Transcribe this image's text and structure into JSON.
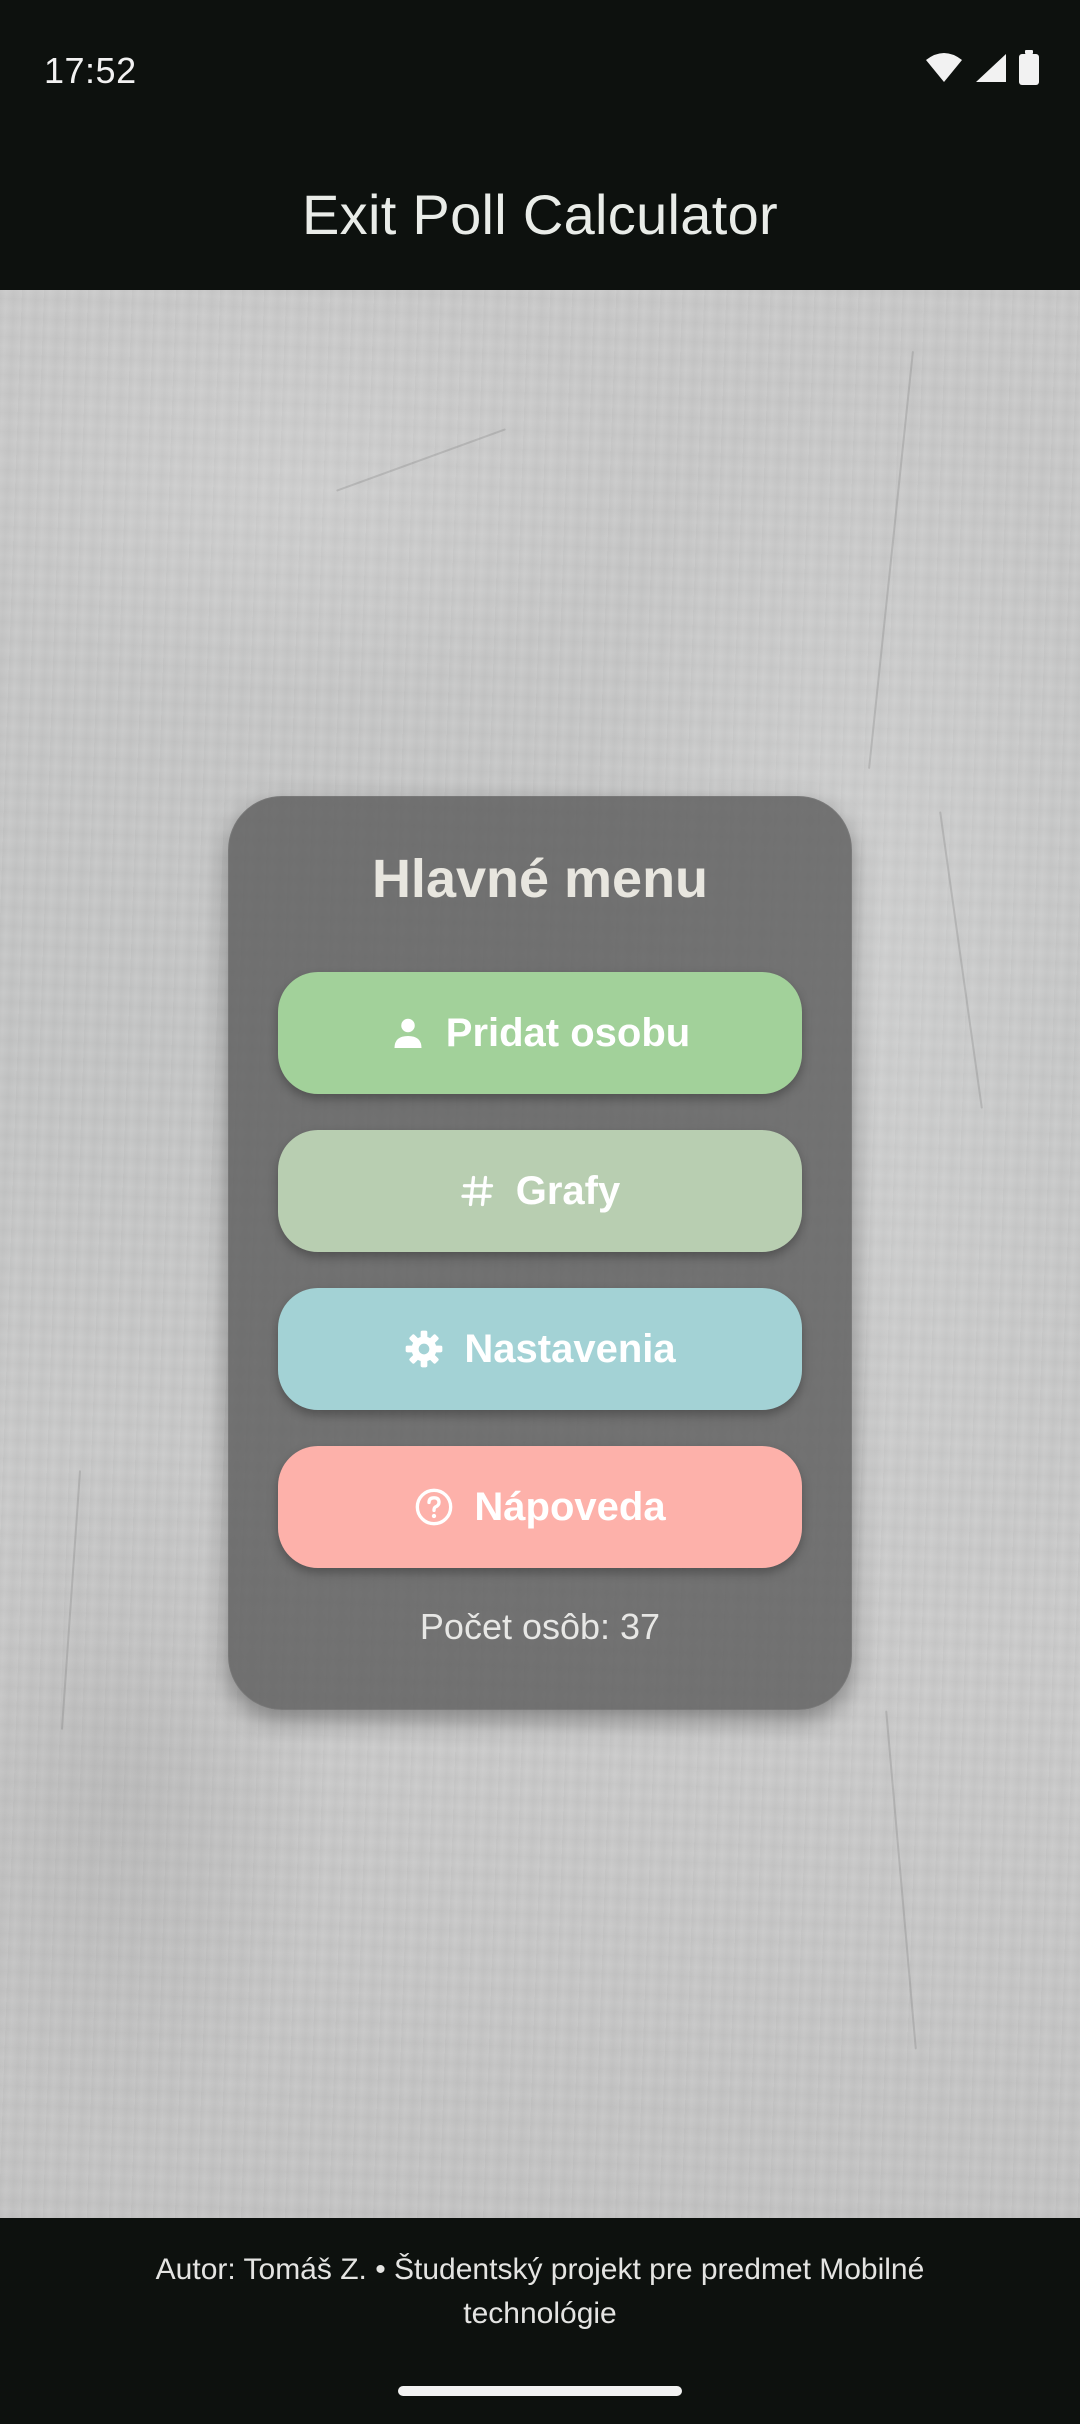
{
  "status_bar": {
    "time": "17:52",
    "icons": [
      "wifi-icon",
      "signal-icon",
      "battery-icon"
    ]
  },
  "app_bar": {
    "title": "Exit Poll Calculator"
  },
  "menu": {
    "title": "Hlavné menu",
    "buttons": [
      {
        "label": "Pridat osobu",
        "icon": "person-icon",
        "color": "#a2d19a"
      },
      {
        "label": "Grafy",
        "icon": "hashtag-icon",
        "color": "#b8ceb1"
      },
      {
        "label": "Nastavenia",
        "icon": "gear-icon",
        "color": "#a3d2d5"
      },
      {
        "label": "Nápoveda",
        "icon": "help-circle-icon",
        "color": "#fdb1aa"
      }
    ],
    "count_text": "Počet osôb: 37"
  },
  "footer": {
    "text": "Autor: Tomáš Z.  •  Študentský projekt pre predmet Mobilné technológie"
  },
  "colors": {
    "background_dark": "#0d110e",
    "card": "#585858"
  }
}
